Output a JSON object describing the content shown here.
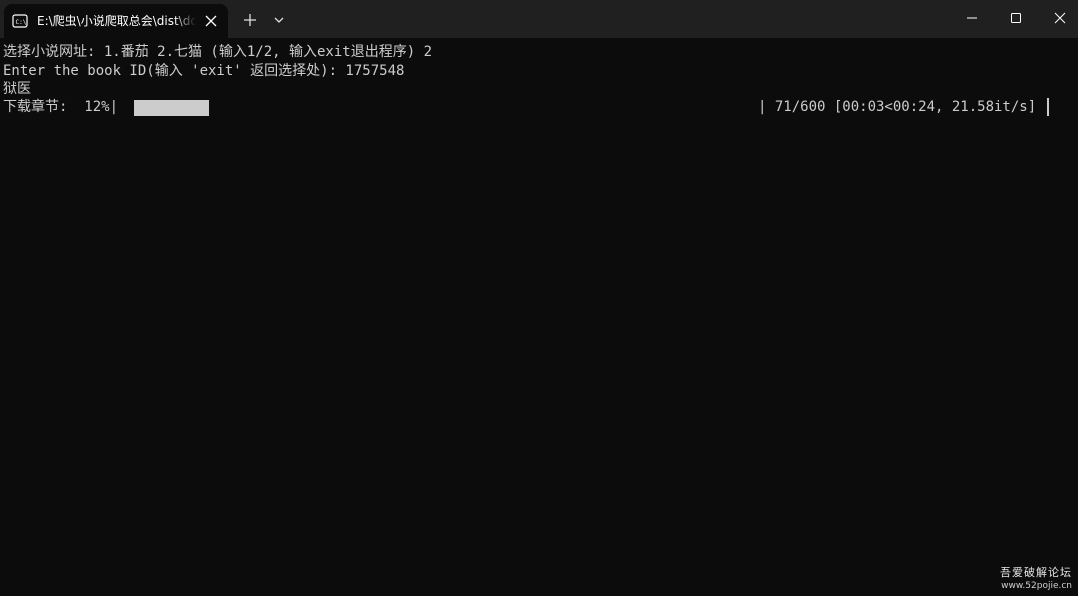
{
  "window": {
    "tab_title": "E:\\爬虫\\小说爬取总会\\dist\\dow",
    "tab_icon": "terminal-icon",
    "controls": [
      "new-tab",
      "dropdown",
      "minimize",
      "maximize",
      "close"
    ]
  },
  "terminal": {
    "line1": "选择小说网址: 1.番茄 2.七猫 (输入1/2, 输入exit退出程序) 2",
    "line2": "Enter the book ID(输入 'exit' 返回选择处): 1757548",
    "line3": "狱医",
    "progress": {
      "label": "下载章节:  12%|",
      "fraction": 0.12,
      "stats": "| 71/600 [00:03<00:24, 21.58it/s]"
    }
  },
  "watermark": {
    "title": "吾爱破解论坛",
    "url": "www.52pojie.cn"
  },
  "colors": {
    "background": "#0c0c0c",
    "titlebar": "#202020",
    "text": "#cccccc"
  }
}
